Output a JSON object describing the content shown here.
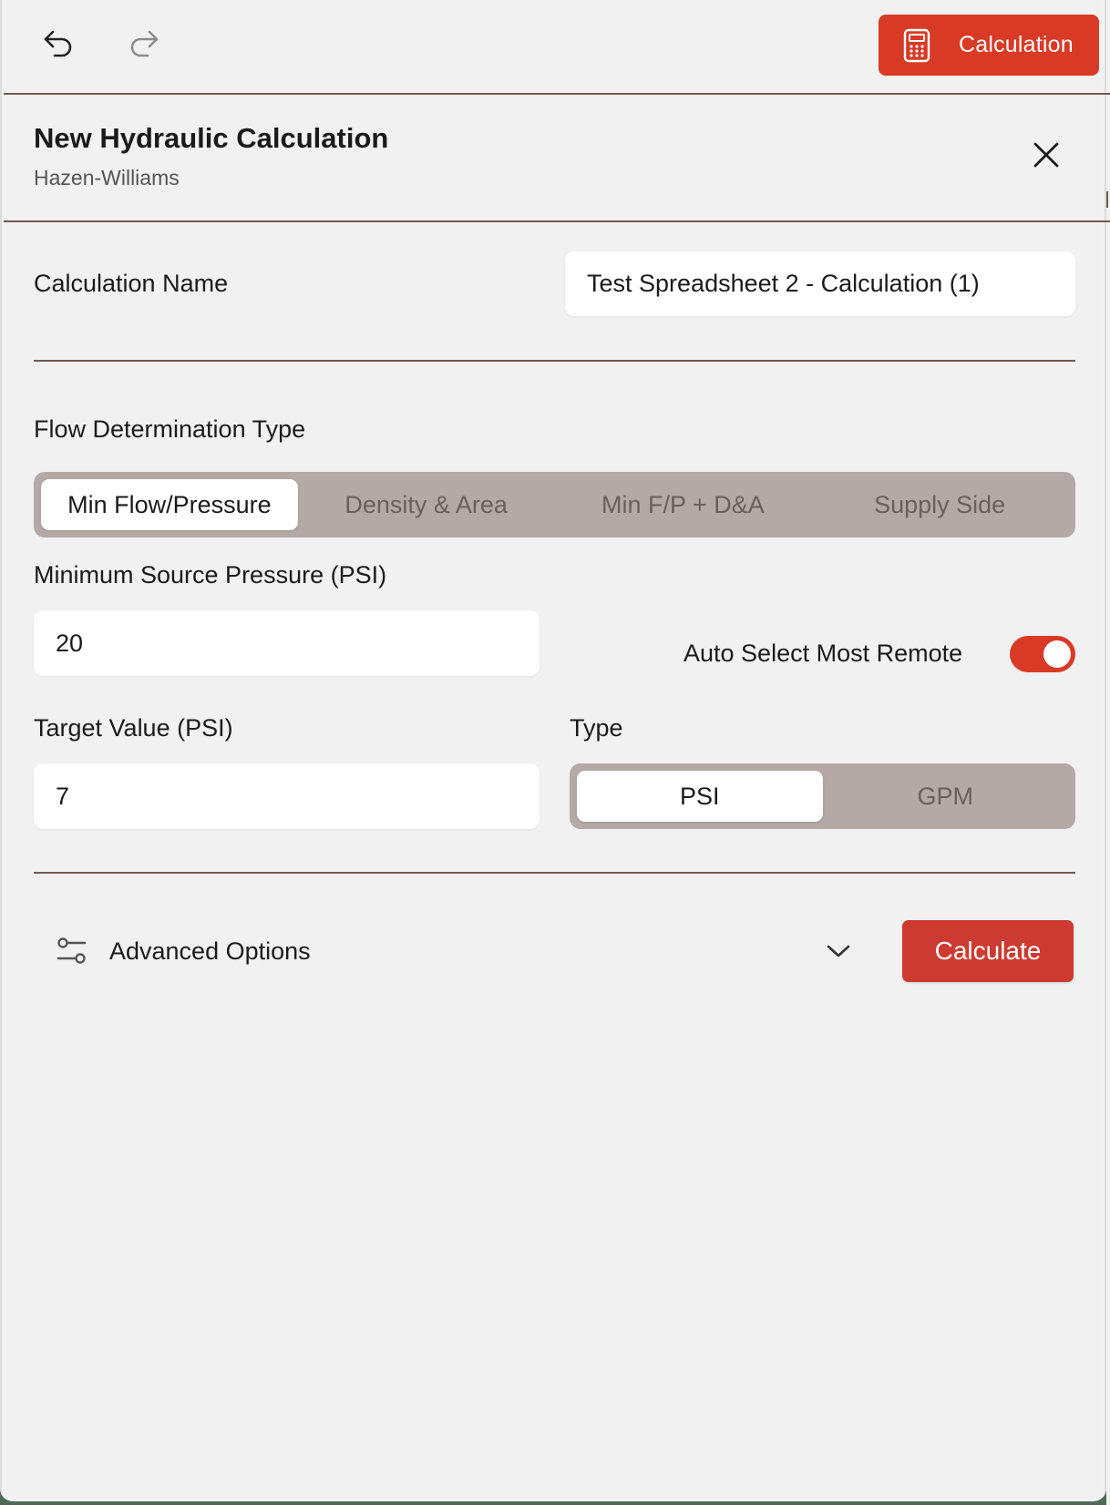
{
  "toolbar": {
    "undo_icon": "undo-icon",
    "redo_icon": "redo-icon",
    "calculation_button_label": "Calculation",
    "calculation_button_icon": "calculator-icon",
    "accent_color": "#d83a26"
  },
  "header": {
    "title": "New Hydraulic Calculation",
    "subtitle": "Hazen-Williams",
    "close_icon": "close-icon"
  },
  "form": {
    "calculation_name": {
      "label": "Calculation Name",
      "value": "Test Spreadsheet 2 - Calculation (1)"
    },
    "flow_determination": {
      "label": "Flow Determination Type",
      "options": [
        "Min Flow/Pressure",
        "Density & Area",
        "Min F/P + D&A",
        "Supply Side"
      ],
      "selected": "Min Flow/Pressure"
    },
    "min_source_pressure": {
      "label": "Minimum Source Pressure (PSI)",
      "value": "20"
    },
    "auto_select": {
      "label": "Auto Select Most Remote",
      "enabled": true
    },
    "target_value": {
      "label": "Target Value (PSI)",
      "value": "7"
    },
    "type": {
      "label": "Type",
      "options": [
        "PSI",
        "GPM"
      ],
      "selected": "PSI"
    }
  },
  "footer": {
    "advanced_options_label": "Advanced Options",
    "advanced_icon": "sliders-icon",
    "chevron_icon": "chevron-down-icon",
    "calculate_label": "Calculate",
    "calculate_color": "#cc3a32"
  }
}
